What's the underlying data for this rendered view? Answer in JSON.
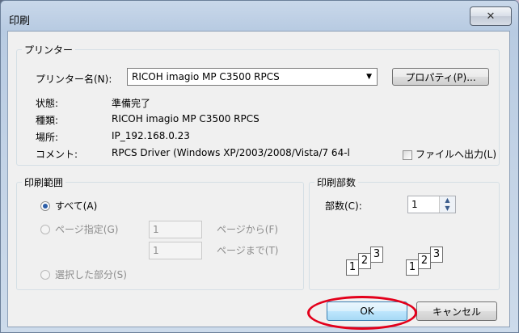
{
  "window": {
    "title": "印刷",
    "close_symbol": "✕"
  },
  "printer": {
    "group_label": "プリンター",
    "name_label": "プリンター名(N):",
    "selected_printer": "RICOH imagio MP C3500 RPCS",
    "properties_button": "プロパティ(P)...",
    "status_label": "状態:",
    "status_value": "準備完了",
    "type_label": "種類:",
    "type_value": "RICOH imagio MP C3500 RPCS",
    "location_label": "場所:",
    "location_value": "IP_192.168.0.23",
    "comment_label": "コメント:",
    "comment_value": "RPCS Driver (Windows XP/2003/2008/Vista/7 64-l",
    "print_to_file_label": "ファイルへ出力(L)",
    "print_to_file_checked": false
  },
  "print_range": {
    "group_label": "印刷範囲",
    "all_label": "すべて(A)",
    "pages_label": "ページ指定(G)",
    "from_value": "1",
    "from_suffix": "ページから(F)",
    "to_value": "1",
    "to_suffix": "ページまで(T)",
    "selection_label": "選択した部分(S)",
    "selected_option": "all"
  },
  "copies": {
    "group_label": "印刷部数",
    "count_label": "部数(C):",
    "count_value": "1",
    "collate_pages": [
      "1",
      "2",
      "3"
    ]
  },
  "footer": {
    "ok_label": "OK",
    "cancel_label": "キャンセル"
  },
  "colors": {
    "highlight": "#e3001b",
    "title_gradient": "#b8cbe2"
  },
  "icons": {
    "spin_up": "▲",
    "spin_down": "▼",
    "dropdown": "▼"
  }
}
